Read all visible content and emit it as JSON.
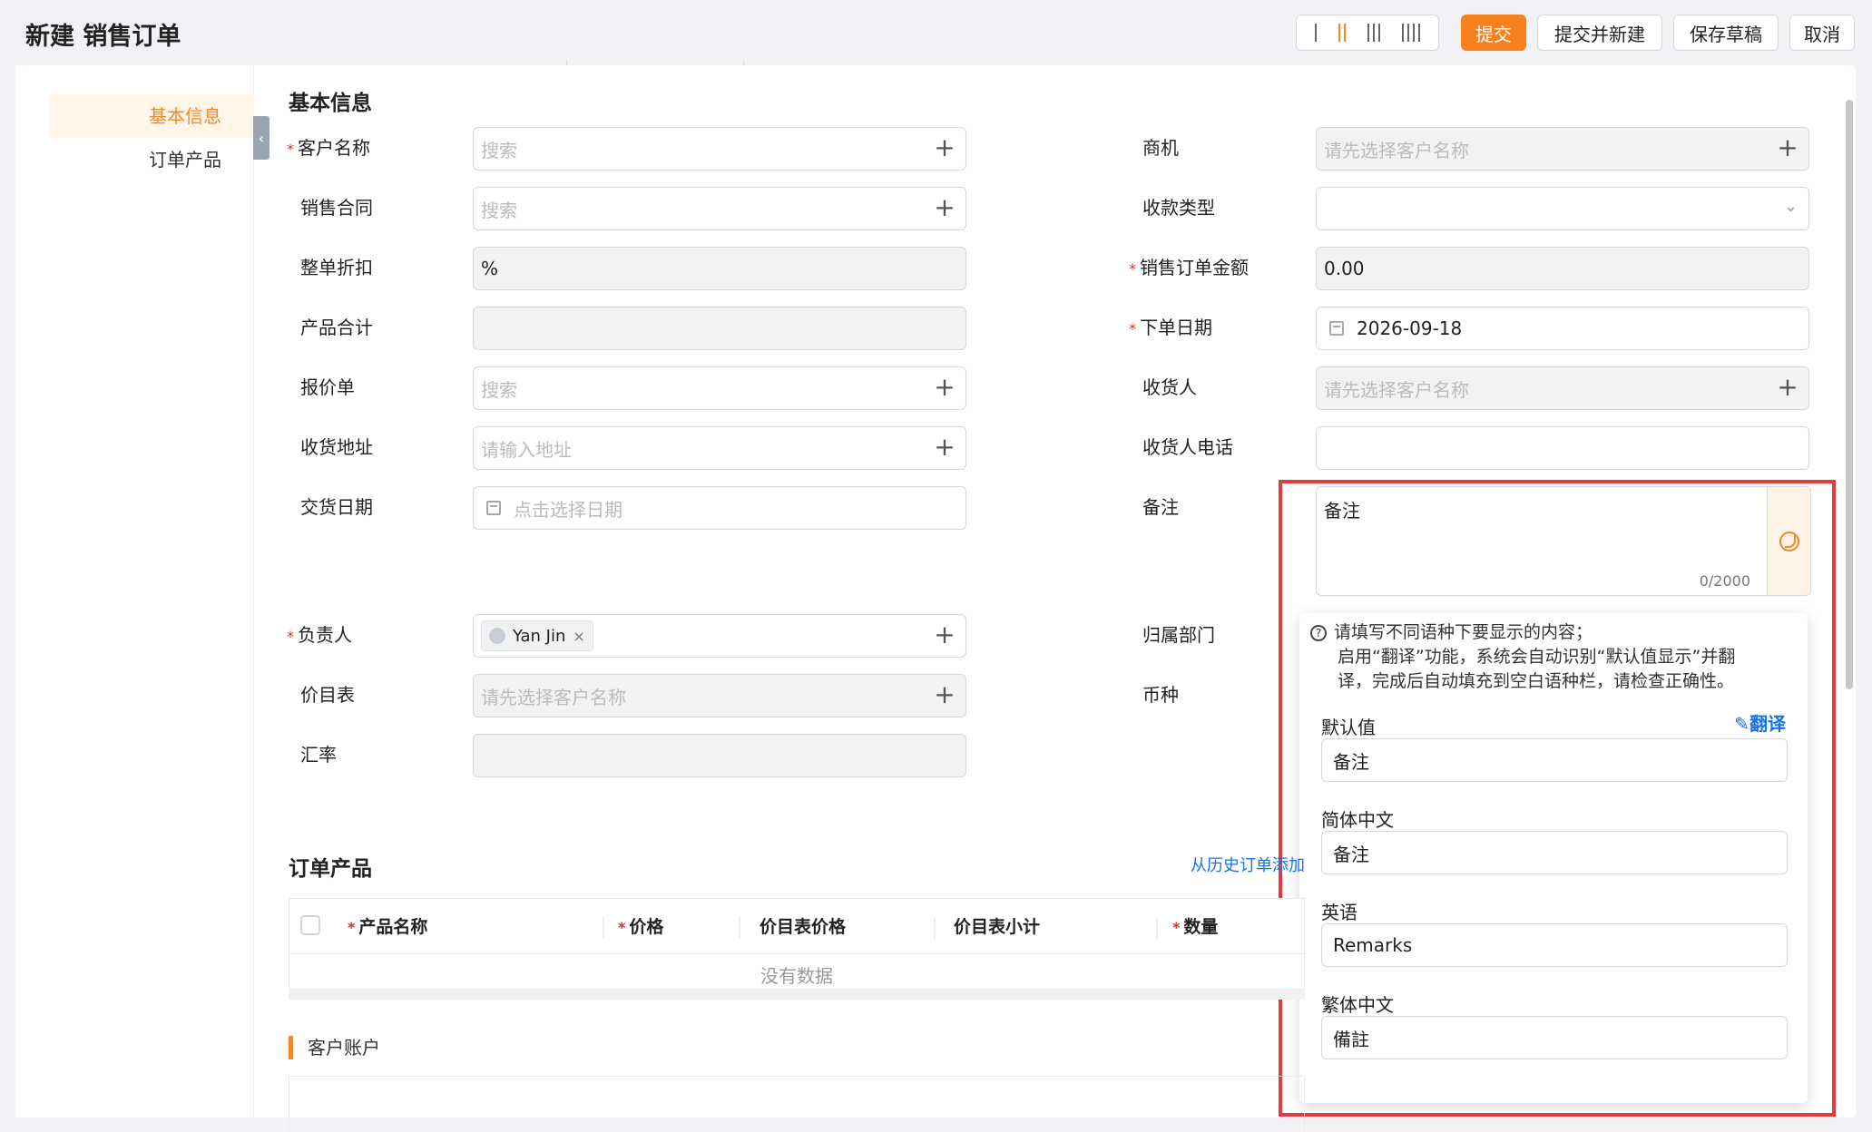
{
  "header": {
    "title": "新建 销售订单",
    "buttons": {
      "submit": "提交",
      "submit_new": "提交并新建",
      "save_draft": "保存草稿",
      "cancel": "取消"
    },
    "accent": "#f7801f"
  },
  "left_tabs": [
    "基本信息",
    "订单产品"
  ],
  "sections": {
    "basic": "基本信息",
    "products": "订单产品",
    "account": "客户账户"
  },
  "form_left": [
    {
      "label": "客户名称",
      "required": true,
      "placeholder": "搜索"
    },
    {
      "label": "销售合同",
      "required": false,
      "placeholder": "搜索"
    },
    {
      "label": "整单折扣",
      "required": false,
      "value": "%"
    },
    {
      "label": "产品合计",
      "required": false,
      "value": ""
    },
    {
      "label": "报价单",
      "required": false,
      "placeholder": "搜索"
    },
    {
      "label": "收货地址",
      "required": false,
      "placeholder": "请输入地址"
    },
    {
      "label": "交货日期",
      "required": false,
      "placeholder": "点击选择日期"
    },
    {
      "label": "负责人",
      "required": true,
      "value": "Yan Jin"
    },
    {
      "label": "价目表",
      "required": false,
      "placeholder": "请先选择客户名称"
    },
    {
      "label": "汇率",
      "required": false,
      "value": ""
    }
  ],
  "form_right": [
    {
      "label": "商机",
      "required": false,
      "placeholder": "请先选择客户名称"
    },
    {
      "label": "收款类型",
      "required": false,
      "value": ""
    },
    {
      "label": "销售订单金额",
      "required": true,
      "value": "0.00"
    },
    {
      "label": "下单日期",
      "required": true,
      "value": "2026-09-18"
    },
    {
      "label": "收货人",
      "required": false,
      "placeholder": "请先选择客户名称"
    },
    {
      "label": "收货人电话",
      "required": false,
      "value": ""
    },
    {
      "label": "备注",
      "required": false,
      "value": "备注",
      "count": "0/2000"
    },
    {
      "label": "归属部门",
      "required": false
    },
    {
      "label": "币种",
      "required": false
    }
  ],
  "popover": {
    "hint_line1": "请填写不同语种下要显示的内容；",
    "hint_line2": "启用“翻译”功能，系统会自动识别“默认值显示”并翻",
    "hint_line3": "译，完成后自动填充到空白语种栏，请检查正确性。",
    "translate": "翻译",
    "languages": [
      {
        "label": "默认值",
        "value": "备注"
      },
      {
        "label": "简体中文",
        "value": "备注"
      },
      {
        "label": "英语",
        "value": "Remarks"
      },
      {
        "label": "繁体中文",
        "value": "備註"
      }
    ]
  },
  "products_table": {
    "link": "从历史订单添加",
    "headers": [
      "产品名称",
      "价格",
      "价目表价格",
      "价目表小计",
      "数量"
    ],
    "empty": "没有数据"
  }
}
